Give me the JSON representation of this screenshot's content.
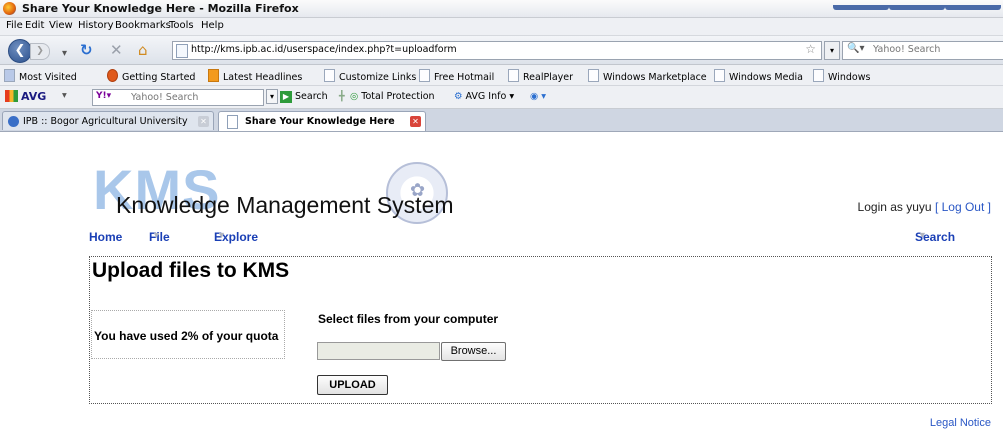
{
  "window": {
    "title": "Share Your Knowledge Here - Mozilla Firefox"
  },
  "menu": [
    "File",
    "Edit",
    "View",
    "History",
    "Bookmarks",
    "Tools",
    "Help"
  ],
  "nav": {
    "url": "http://kms.ipb.ac.id/userspace/index.php?t=uploadform",
    "search_placeholder": "Yahoo! Search"
  },
  "bookmarks": [
    "Most Visited",
    "Getting Started",
    "Latest Headlines",
    "Customize Links",
    "Free Hotmail",
    "RealPlayer",
    "Windows Marketplace",
    "Windows Media",
    "Windows"
  ],
  "avg": {
    "brand": "AVG",
    "search_placeholder": "Yahoo! Search",
    "search": "Search",
    "total_protection": "Total Protection",
    "avg_info": "AVG Info"
  },
  "tabs": [
    {
      "label": "IPB :: Bogor Agricultural University"
    },
    {
      "label": "Share Your Knowledge Here"
    }
  ],
  "page": {
    "logo": "KMS",
    "system_title": "Knowledge Management System",
    "login_prefix": "Login as yuyu",
    "logout": "[ Log Out ]",
    "nav": {
      "home": "Home",
      "file": "File",
      "explore": "Explore",
      "search": "Search"
    },
    "heading": "Upload files to KMS",
    "quota": "You have used 2% of your quota",
    "select_header": "Select files from your computer",
    "browse": "Browse...",
    "upload": "UPLOAD",
    "legal": "Legal Notice"
  },
  "colors": {
    "link": "#2a57c5",
    "nav": "#1a3fb5",
    "logo": "#a9c7ea"
  }
}
